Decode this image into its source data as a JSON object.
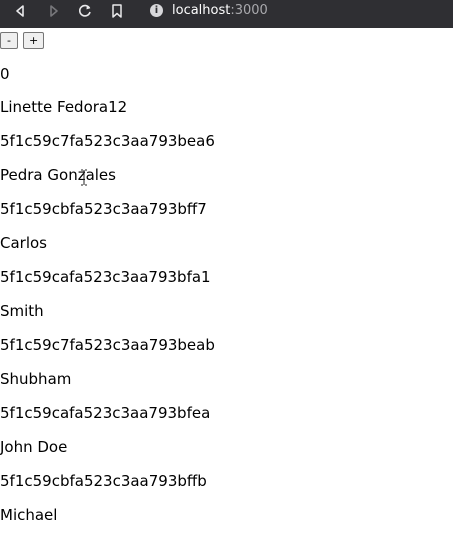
{
  "browser": {
    "url_host": "localhost",
    "url_port": ":3000",
    "info_symbol": "i"
  },
  "counter": {
    "decrement_label": "-",
    "increment_label": "+",
    "value": "0"
  },
  "users": [
    {
      "name": "Linette Fedora12",
      "id": "5f1c59c7fa523c3aa793bea6"
    },
    {
      "name": "Pedra Gonzales",
      "id": "5f1c59cbfa523c3aa793bff7"
    },
    {
      "name": "Carlos",
      "id": "5f1c59cafa523c3aa793bfa1"
    },
    {
      "name": "Smith",
      "id": "5f1c59c7fa523c3aa793beab"
    },
    {
      "name": "Shubham",
      "id": "5f1c59cafa523c3aa793bfea"
    },
    {
      "name": "John Doe",
      "id": "5f1c59cbfa523c3aa793bffb"
    },
    {
      "name": "Michael",
      "id": ""
    }
  ],
  "icons": {
    "back": "back-arrow-icon",
    "forward": "forward-arrow-icon",
    "reload": "reload-icon",
    "bookmark": "bookmark-icon",
    "info": "info-icon"
  }
}
